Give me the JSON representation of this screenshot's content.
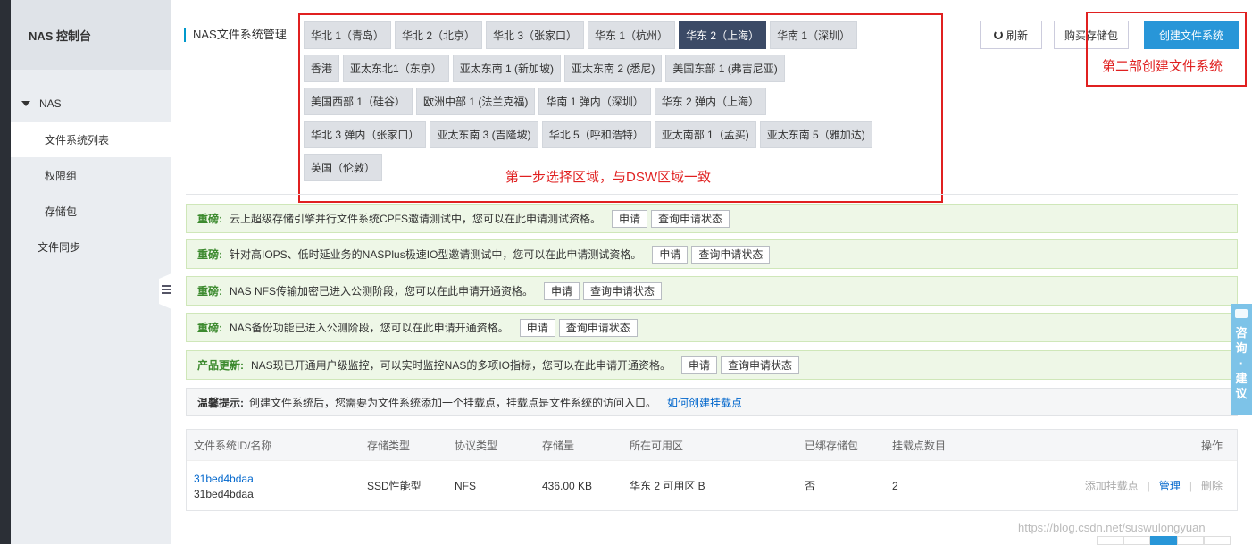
{
  "sidebar": {
    "title": "NAS 控制台",
    "group": "NAS",
    "items": [
      {
        "label": "文件系统列表"
      },
      {
        "label": "权限组"
      },
      {
        "label": "存储包"
      }
    ],
    "top_item": "文件同步"
  },
  "header": {
    "title": "NAS文件系统管理",
    "refresh_label": "刷新",
    "buy_label": "购买存储包",
    "create_label": "创建文件系统"
  },
  "regions": {
    "rows": [
      [
        "华北 1（青岛）",
        "华北 2（北京）",
        "华北 3（张家口）",
        "华东 1（杭州）",
        "华东 2（上海）",
        "华南 1（深圳）"
      ],
      [
        "香港",
        "亚太东北1（东京）",
        "亚太东南 1 (新加坡)",
        "亚太东南 2 (悉尼)",
        "美国东部 1 (弗吉尼亚)"
      ],
      [
        "美国西部 1（硅谷）",
        "欧洲中部 1 (法兰克福)",
        "华南 1 弹内（深圳）",
        "华东 2 弹内（上海）"
      ],
      [
        "华北 3 弹内（张家口）",
        "亚太东南 3 (吉隆坡)",
        "华北 5（呼和浩特）",
        "亚太南部 1（孟买)",
        "亚太东南 5（雅加达)"
      ],
      [
        "英国（伦敦）"
      ]
    ],
    "selected": "华东 2（上海）"
  },
  "annotations": {
    "step1": "第一步选择区域，与DSW区域一致",
    "step2": "第二部创建文件系统"
  },
  "notices": [
    {
      "tag": "重磅:",
      "text": "云上超级存储引擎并行文件系统CPFS邀请测试中，您可以在此申请测试资格。",
      "apply": "申请",
      "query": "查询申请状态"
    },
    {
      "tag": "重磅:",
      "text": "针对高IOPS、低时延业务的NASPlus极速IO型邀请测试中，您可以在此申请测试资格。",
      "apply": "申请",
      "query": "查询申请状态"
    },
    {
      "tag": "重磅:",
      "text": "NAS NFS传输加密已进入公测阶段，您可以在此申请开通资格。",
      "apply": "申请",
      "query": "查询申请状态"
    },
    {
      "tag": "重磅:",
      "text": "NAS备份功能已进入公测阶段，您可以在此申请开通资格。",
      "apply": "申请",
      "query": "查询申请状态"
    },
    {
      "tag": "产品更新:",
      "text": "NAS现已开通用户级监控，可以实时监控NAS的多项IO指标，您可以在此申请开通资格。",
      "apply": "申请",
      "query": "查询申请状态"
    }
  ],
  "tip": {
    "tag": "温馨提示:",
    "text": "创建文件系统后，您需要为文件系统添加一个挂载点，挂载点是文件系统的访问入口。",
    "link": "如何创建挂载点"
  },
  "table": {
    "headers": [
      "文件系统ID/名称",
      "存储类型",
      "协议类型",
      "存储量",
      "所在可用区",
      "已绑存储包",
      "挂载点数目",
      "操作"
    ],
    "rows": [
      {
        "id": "31bed4bdaa",
        "name": "31bed4bdaa",
        "storage_type": "SSD性能型",
        "protocol": "NFS",
        "size": "436.00 KB",
        "zone": "华东 2 可用区 B",
        "bound": "否",
        "mounts": "2",
        "op_add": "添加挂载点",
        "op_manage": "管理",
        "op_delete": "删除"
      }
    ]
  },
  "float_help": {
    "chars": [
      "咨",
      "询",
      "·",
      "建",
      "议"
    ]
  },
  "watermark": "https://blog.csdn.net/suswulongyuan",
  "colors": {
    "primary": "#2896d8",
    "annotation": "#e02020",
    "notice_bg": "#eef7e7",
    "selected_region": "#3b4a66"
  }
}
